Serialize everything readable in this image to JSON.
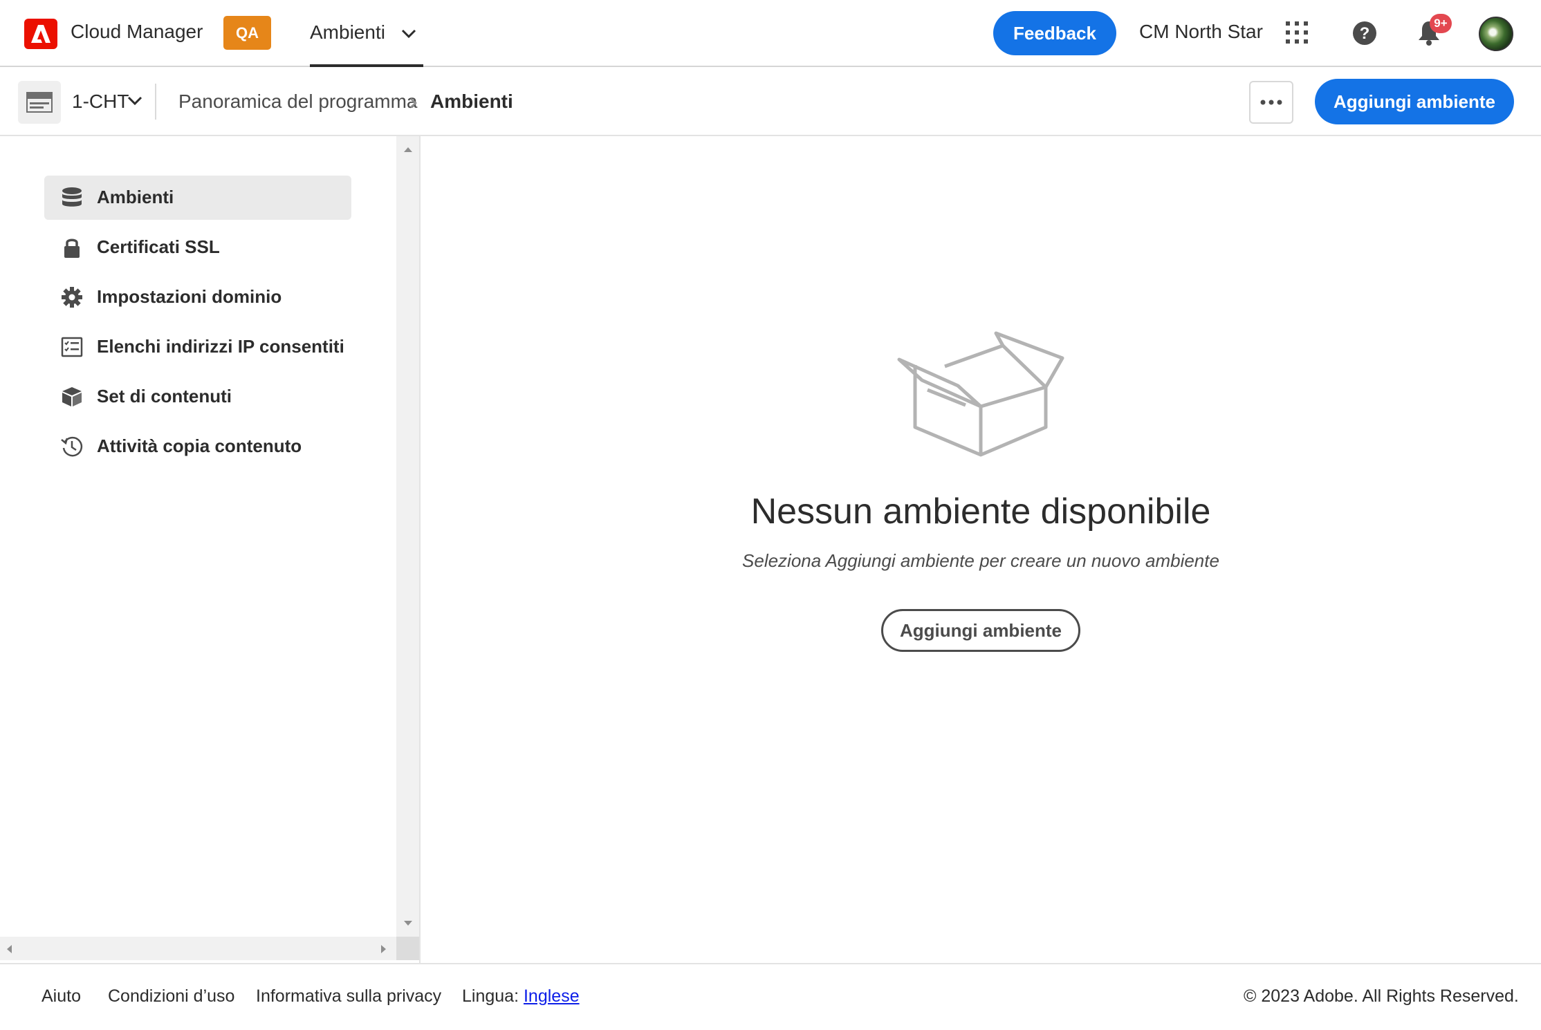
{
  "header": {
    "app_name": "Cloud Manager",
    "env_badge": "QA",
    "nav_tab": "Ambienti",
    "feedback_label": "Feedback",
    "org_name": "CM North Star",
    "notification_badge": "9+",
    "colors": {
      "accent": "#1473e6",
      "badge": "#e68619",
      "brand": "#eb1000",
      "notification": "#e34850"
    }
  },
  "subheader": {
    "program_name": "1-CHT",
    "breadcrumb": [
      "Panoramica del programma",
      "Ambienti"
    ],
    "add_environment_label": "Aggiungi ambiente"
  },
  "sidebar": {
    "items": [
      {
        "label": "Ambienti",
        "icon": "database-icon",
        "active": true
      },
      {
        "label": "Certificati SSL",
        "icon": "lock-icon",
        "active": false
      },
      {
        "label": "Impostazioni dominio",
        "icon": "gear-icon",
        "active": false
      },
      {
        "label": "Elenchi indirizzi IP consentiti",
        "icon": "checklist-icon",
        "active": false
      },
      {
        "label": "Set di contenuti",
        "icon": "boxes-icon",
        "active": false
      },
      {
        "label": "Attività copia contenuto",
        "icon": "history-icon",
        "active": false
      }
    ]
  },
  "main": {
    "empty_title": "Nessun ambiente disponibile",
    "empty_subtitle": "Seleziona Aggiungi ambiente per creare un nuovo ambiente",
    "add_environment_label": "Aggiungi ambiente"
  },
  "footer": {
    "links": [
      "Aiuto",
      "Condizioni d’uso",
      "Informativa sulla privacy"
    ],
    "language_prefix": "Lingua:",
    "language_value": "Inglese",
    "copyright": "© 2023 Adobe. All Rights Reserved."
  }
}
